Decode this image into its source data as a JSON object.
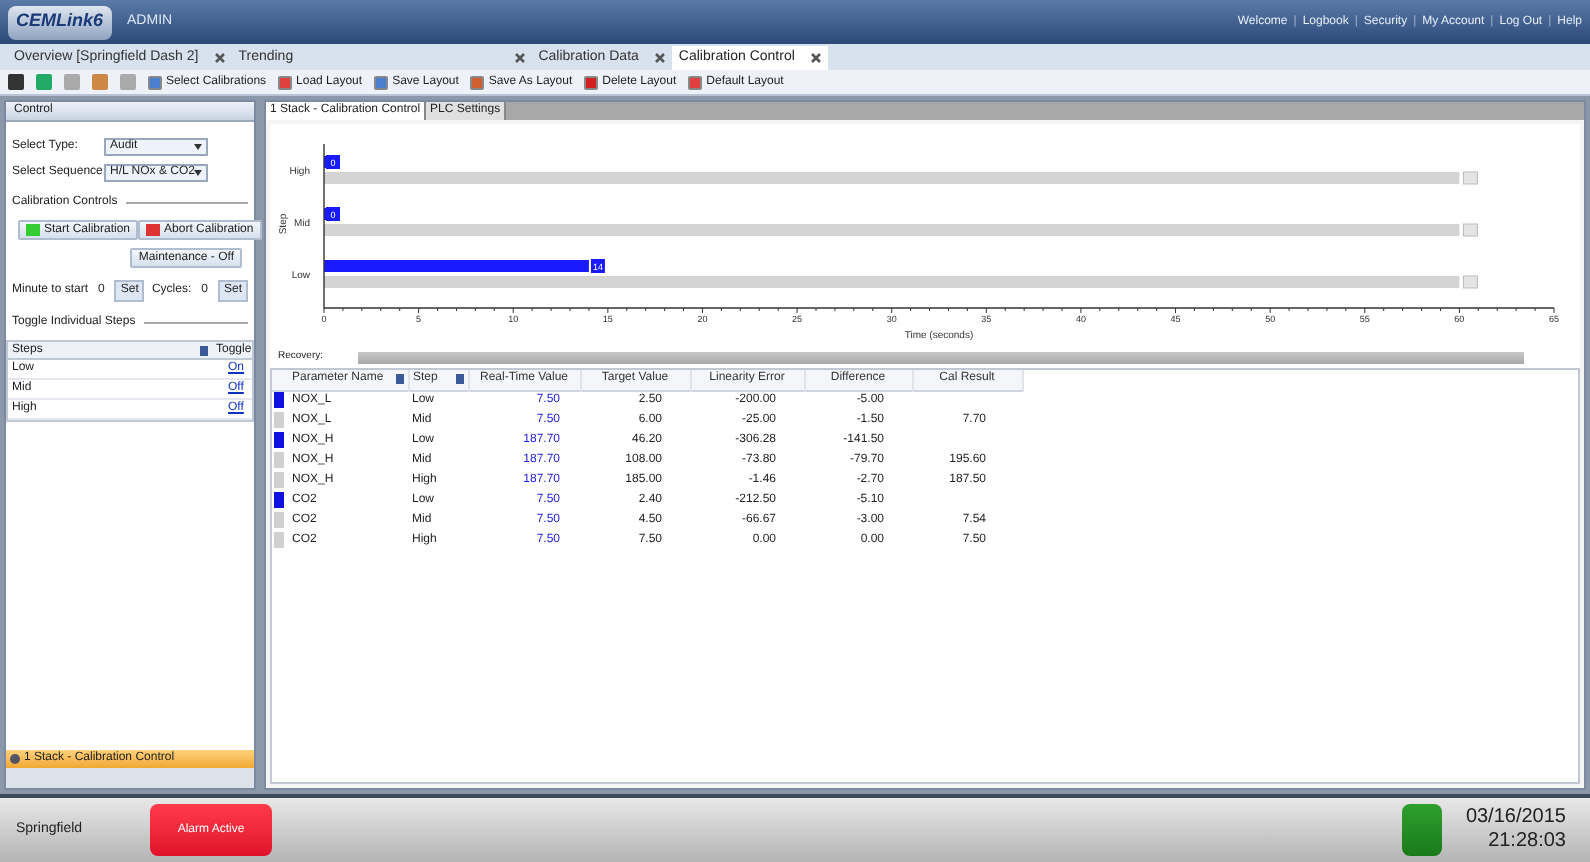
{
  "header": {
    "logo": "CEMLink6",
    "role": "ADMIN",
    "links": [
      "Welcome",
      "Logbook",
      "Security",
      "My Account",
      "Log Out",
      "Help"
    ],
    "separator": "|"
  },
  "tabs": [
    {
      "label": "Overview [Springfield Dash 2]",
      "selected": false
    },
    {
      "label": "Trending",
      "selected": false
    },
    {
      "label": "Calibration Data",
      "selected": false
    },
    {
      "label": "Calibration Control",
      "selected": true
    }
  ],
  "toolbar": [
    "Select Calibrations",
    "Load Layout",
    "Save Layout",
    "Save As Layout",
    "Delete Layout",
    "Default Layout"
  ],
  "control_panel": {
    "title": "Control",
    "select_type": {
      "label": "Select Type:",
      "value": "Audit"
    },
    "select_sequence": {
      "label": "Select Sequence:",
      "value": "H/L NOx & CO2"
    },
    "calibration_controls": {
      "title": "Calibration Controls",
      "start": "Start Calibration",
      "abort": "Abort Calibration",
      "maintenance": "Maintenance - Off"
    },
    "minute_to_start": {
      "label": "Minute to start",
      "value": "0",
      "button": "Set"
    },
    "cycles": {
      "label": "Cycles:",
      "value": "0",
      "button": "Set"
    },
    "toggle_steps": {
      "title": "Toggle Individual Steps",
      "columns": [
        "Steps",
        "Toggle"
      ],
      "rows": [
        {
          "step": "Low",
          "toggle": "On"
        },
        {
          "step": "Mid",
          "toggle": "Off"
        },
        {
          "step": "High",
          "toggle": "Off"
        }
      ]
    },
    "stack_item": "1 Stack - Calibration Control"
  },
  "inner_tabs": [
    {
      "label": "1 Stack - Calibration Control",
      "selected": true
    },
    {
      "label": "PLC Settings",
      "selected": false
    }
  ],
  "chart_data": {
    "type": "bar",
    "orientation": "horizontal",
    "xlabel": "Time (seconds)",
    "ylabel": "Step",
    "categories": [
      "High",
      "Mid",
      "Low"
    ],
    "series": [
      {
        "color": "#1a1aff",
        "values": [
          0,
          0,
          14
        ]
      },
      {
        "color": "#d4d4d4",
        "values": [
          60,
          60,
          60
        ]
      }
    ],
    "value_labels": [
      "0",
      "0",
      "14"
    ],
    "xlim": [
      0,
      65
    ],
    "xticks": [
      0,
      5,
      10,
      15,
      20,
      25,
      30,
      35,
      40,
      45,
      50,
      55,
      60,
      65
    ]
  },
  "recovery": {
    "label": "Recovery:"
  },
  "table": {
    "columns": [
      "Parameter Name",
      "Step",
      "Real-Time Value",
      "Target Value",
      "Linearity Error",
      "Difference",
      "Cal Result"
    ],
    "rows": [
      {
        "active": true,
        "cells": [
          "NOX_L",
          "Low",
          "7.50",
          "2.50",
          "-200.00",
          "-5.00",
          ""
        ]
      },
      {
        "active": false,
        "cells": [
          "NOX_L",
          "Mid",
          "7.50",
          "6.00",
          "-25.00",
          "-1.50",
          "7.70"
        ]
      },
      {
        "active": true,
        "cells": [
          "NOX_H",
          "Low",
          "187.70",
          "46.20",
          "-306.28",
          "-141.50",
          ""
        ]
      },
      {
        "active": false,
        "cells": [
          "NOX_H",
          "Mid",
          "187.70",
          "108.00",
          "-73.80",
          "-79.70",
          "195.60"
        ]
      },
      {
        "active": false,
        "cells": [
          "NOX_H",
          "High",
          "187.70",
          "185.00",
          "-1.46",
          "-2.70",
          "187.50"
        ]
      },
      {
        "active": true,
        "cells": [
          "CO2",
          "Low",
          "7.50",
          "2.40",
          "-212.50",
          "-5.10",
          ""
        ]
      },
      {
        "active": false,
        "cells": [
          "CO2",
          "Mid",
          "7.50",
          "4.50",
          "-66.67",
          "-3.00",
          "7.54"
        ]
      },
      {
        "active": false,
        "cells": [
          "CO2",
          "High",
          "7.50",
          "7.50",
          "0.00",
          "0.00",
          "7.50"
        ]
      }
    ]
  },
  "status_bar": {
    "site": "Springfield",
    "alarm": "Alarm Active",
    "date": "03/16/2015",
    "time": "21:28:03"
  }
}
